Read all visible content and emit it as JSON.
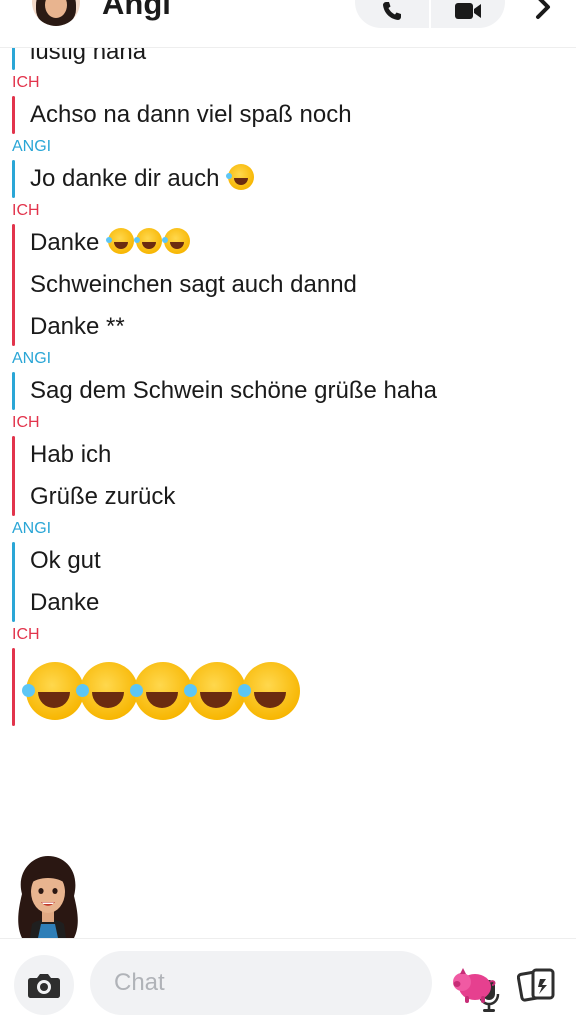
{
  "header": {
    "contact_name": "Angi",
    "icons": [
      "phone-icon",
      "video-icon",
      "chevron-right-icon"
    ]
  },
  "messages": [
    {
      "sender": "",
      "side": "them",
      "lines": [
        "lustig haha"
      ]
    },
    {
      "sender": "ICH",
      "side": "me",
      "lines": [
        "Achso na dann viel spaß noch"
      ]
    },
    {
      "sender": "ANGI",
      "side": "them",
      "lines": [
        "Jo danke dir auch"
      ]
    },
    {
      "sender": "ICH",
      "side": "me",
      "lines": [
        "Danke",
        "Schweinchen sagt auch dannd",
        "Danke **"
      ]
    },
    {
      "sender": "ANGI",
      "side": "them",
      "lines": [
        "Sag dem Schwein schöne grüße haha"
      ]
    },
    {
      "sender": "ICH",
      "side": "me",
      "lines": [
        "Hab ich",
        "Grüße zurück"
      ]
    },
    {
      "sender": "ANGI",
      "side": "them",
      "lines": [
        "Ok gut",
        "Danke"
      ]
    },
    {
      "sender": "ICH",
      "side": "me",
      "lines": []
    }
  ],
  "emoji": {
    "name": "rolling-on-floor-laughing",
    "big_count": 5
  },
  "composer": {
    "placeholder": "Chat"
  },
  "colors": {
    "me": "#e2344c",
    "them": "#2aa6d6",
    "input_bg": "#f1f2f4"
  }
}
